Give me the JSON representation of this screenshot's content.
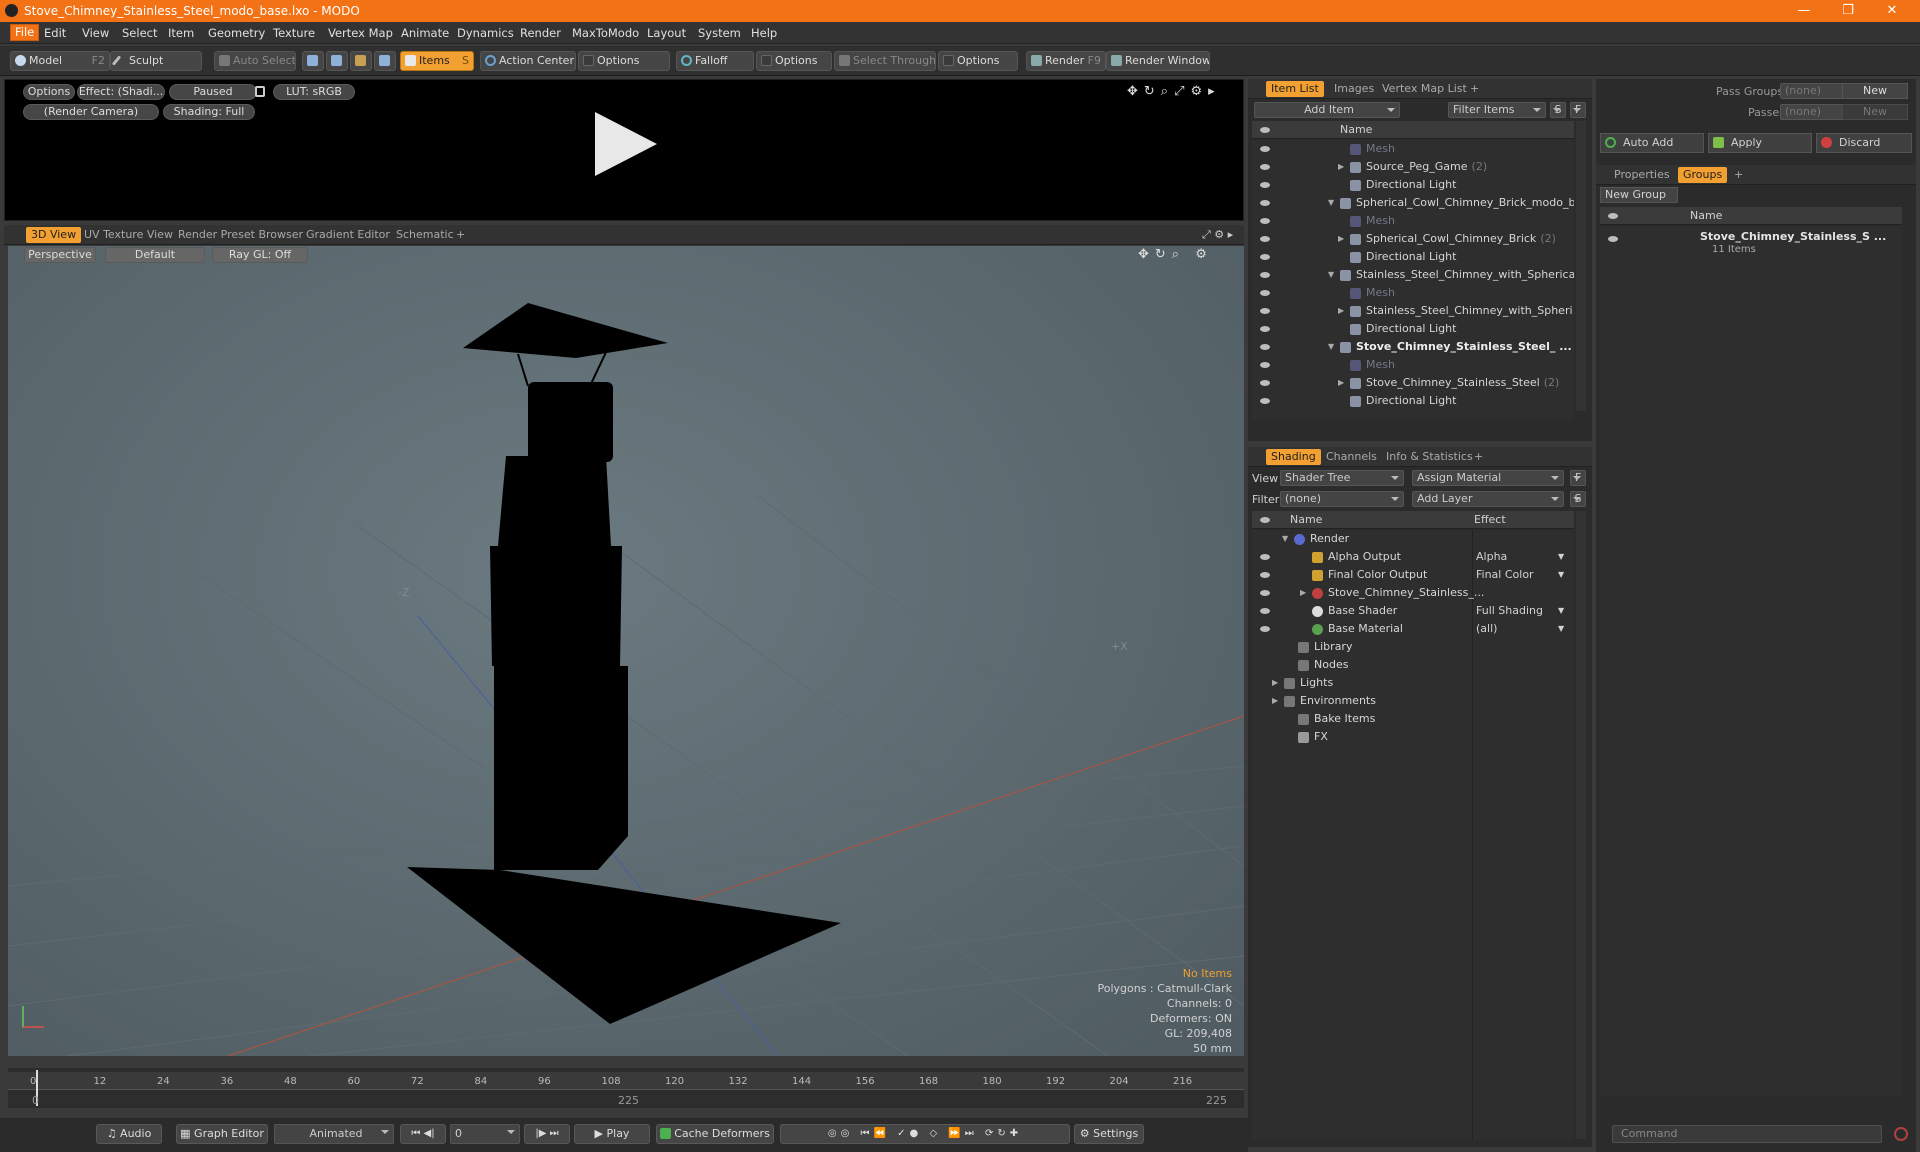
{
  "window": {
    "title": "Stove_Chimney_Stainless_Steel_modo_base.lxo - MODO"
  },
  "menu": [
    "File",
    "Edit",
    "View",
    "Select",
    "Item",
    "Geometry",
    "Texture",
    "Vertex Map",
    "Animate",
    "Dynamics",
    "Render",
    "MaxToModo",
    "Layout",
    "System",
    "Help"
  ],
  "toolbar": {
    "model": "Model",
    "model_key": "F2",
    "sculpt": "Sculpt",
    "auto_select": "Auto Select",
    "items": "Items",
    "items_key": "S",
    "action_center": "Action Center",
    "options1": "Options",
    "falloff": "Falloff",
    "options2": "Options",
    "select_through": "Select Through",
    "options3": "Options",
    "render": "Render",
    "render_key": "F9",
    "render_window": "Render Window"
  },
  "preview": {
    "options": "Options",
    "effect": "Effect: (Shadi...",
    "paused": "Paused",
    "lut": "LUT: sRGB",
    "camera": "(Render Camera)",
    "shading": "Shading: Full"
  },
  "viewport_tabs": [
    "3D View",
    "UV Texture View",
    "Render Preset Browser",
    "Gradient Editor",
    "Schematic"
  ],
  "viewport": {
    "perspective": "Perspective",
    "default": "Default",
    "raygl": "Ray GL: Off",
    "axis_neg_z": "-Z",
    "axis_pos_x": "+X",
    "stats": {
      "no_items": "No Items",
      "polygons": "Polygons : Catmull-Clark",
      "channels": "Channels: 0",
      "deformers": "Deformers: ON",
      "gl": "GL: 209,408",
      "lens": "50 mm"
    }
  },
  "timeline": {
    "ticks": [
      "0",
      "12",
      "24",
      "36",
      "48",
      "60",
      "72",
      "84",
      "96",
      "108",
      "120",
      "132",
      "144",
      "156",
      "168",
      "180",
      "192",
      "204",
      "216"
    ],
    "start": "0",
    "mid": "225",
    "end": "225"
  },
  "bottom": {
    "audio": "Audio",
    "graph_editor": "Graph Editor",
    "animated": "Animated",
    "frame": "0",
    "play": "Play",
    "cache": "Cache Deformers",
    "settings": "Settings"
  },
  "itemlist": {
    "tabs": [
      "Item List",
      "Images",
      "Vertex Map List"
    ],
    "add_item": "Add Item",
    "filter": "Filter Items",
    "s": "S",
    "f": "F",
    "col_name": "Name",
    "rows": [
      {
        "label": "Mesh",
        "indent": 90,
        "dim": true,
        "arrow": ""
      },
      {
        "label": "Source_Peg_Game",
        "count": "(2)",
        "indent": 90,
        "arrow": "▶"
      },
      {
        "label": "Directional Light",
        "indent": 90,
        "arrow": ""
      },
      {
        "label": "Spherical_Cowl_Chimney_Brick_modo_b ...",
        "indent": 80,
        "arrow": "▼"
      },
      {
        "label": "Mesh",
        "indent": 90,
        "dim": true,
        "arrow": ""
      },
      {
        "label": "Spherical_Cowl_Chimney_Brick",
        "count": "(2)",
        "indent": 90,
        "arrow": "▶"
      },
      {
        "label": "Directional Light",
        "indent": 90,
        "arrow": ""
      },
      {
        "label": "Stainless_Steel_Chimney_with_Spherical...",
        "indent": 80,
        "arrow": "▼"
      },
      {
        "label": "Mesh",
        "indent": 90,
        "dim": true,
        "arrow": ""
      },
      {
        "label": "Stainless_Steel_Chimney_with_Spheri ...",
        "indent": 90,
        "arrow": "▶"
      },
      {
        "label": "Directional Light",
        "indent": 90,
        "arrow": ""
      },
      {
        "label": "Stove_Chimney_Stainless_Steel_ ...",
        "indent": 80,
        "bold": true,
        "arrow": "▼"
      },
      {
        "label": "Mesh",
        "indent": 90,
        "dim": true,
        "arrow": ""
      },
      {
        "label": "Stove_Chimney_Stainless_Steel",
        "count": "(2)",
        "indent": 90,
        "arrow": "▶"
      },
      {
        "label": "Directional Light",
        "indent": 90,
        "arrow": ""
      }
    ]
  },
  "shading": {
    "tabs": [
      "Shading",
      "Channels",
      "Info & Statistics"
    ],
    "view_label": "View",
    "view_value": "Shader Tree",
    "assign": "Assign Material",
    "filter_label": "Filter",
    "filter_value": "(none)",
    "add_layer": "Add Layer",
    "f": "F",
    "s": "S",
    "col_name": "Name",
    "col_effect": "Effect",
    "rows": [
      {
        "label": "Render",
        "effect": "",
        "indent": 38,
        "arrow": "▼",
        "eye": false
      },
      {
        "label": "Alpha Output",
        "effect": "Alpha",
        "indent": 56,
        "arrow": "",
        "eye": true
      },
      {
        "label": "Final Color Output",
        "effect": "Final Color",
        "indent": 56,
        "arrow": "",
        "eye": true
      },
      {
        "label": "Stove_Chimney_Stainless_...",
        "effect": "",
        "indent": 56,
        "arrow": "▶",
        "eye": true
      },
      {
        "label": "Base Shader",
        "effect": "Full Shading",
        "indent": 56,
        "arrow": "",
        "eye": true
      },
      {
        "label": "Base Material",
        "effect": "(all)",
        "indent": 56,
        "arrow": "",
        "eye": true
      },
      {
        "label": "Library",
        "effect": "",
        "indent": 42,
        "arrow": "",
        "eye": false
      },
      {
        "label": "Nodes",
        "effect": "",
        "indent": 42,
        "arrow": "",
        "eye": false
      },
      {
        "label": "Lights",
        "effect": "",
        "indent": 28,
        "arrow": "▶",
        "eye": false
      },
      {
        "label": "Environments",
        "effect": "",
        "indent": 28,
        "arrow": "▶",
        "eye": false
      },
      {
        "label": "Bake Items",
        "effect": "",
        "indent": 42,
        "arrow": "",
        "eye": false
      },
      {
        "label": "FX",
        "effect": "",
        "indent": 42,
        "arrow": "",
        "eye": false
      }
    ]
  },
  "passes": {
    "pass_groups": "Pass Groups",
    "pass_groups_val": "(none)",
    "new1": "New",
    "passes": "Passes",
    "passes_val": "(none)",
    "new2": "New",
    "auto_add": "Auto Add",
    "apply": "Apply",
    "discard": "Discard"
  },
  "groups": {
    "tabs": [
      "Properties",
      "Groups"
    ],
    "new_group": "New Group",
    "col_name": "Name",
    "item": "Stove_Chimney_Stainless_S ...",
    "items_count": "11 Items"
  },
  "command": {
    "placeholder": "Command"
  }
}
